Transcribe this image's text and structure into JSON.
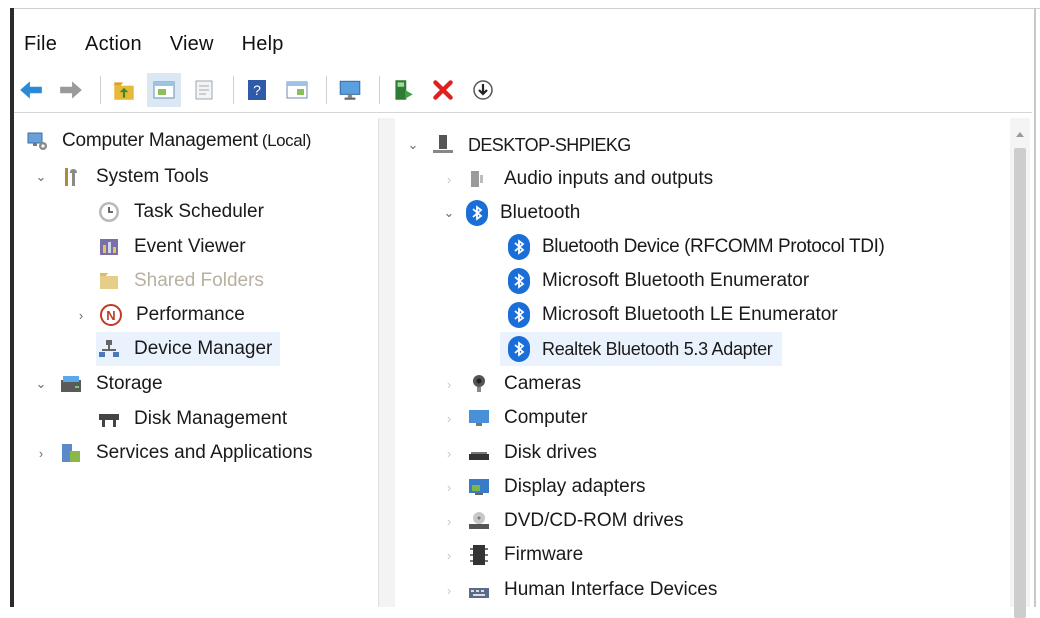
{
  "menu": {
    "file": "File",
    "action": "Action",
    "view": "View",
    "help": "Help"
  },
  "toolbar": {
    "icons": [
      "back-arrow-icon",
      "forward-arrow-icon",
      "up-folder-icon",
      "show-hide-tree-icon",
      "properties-icon",
      "help-icon",
      "export-list-icon",
      "monitor-icon",
      "enable-device-icon",
      "uninstall-icon",
      "update-driver-icon"
    ]
  },
  "tree": {
    "root": "Computer Management",
    "root_suffix": "(Local)",
    "system_tools": "System Tools",
    "task_scheduler": "Task Scheduler",
    "event_viewer": "Event Viewer",
    "shared_folders": "Shared Folders",
    "performance": "Performance",
    "device_manager": "Device Manager",
    "storage": "Storage",
    "disk_management": "Disk Management",
    "services": "Services and Applications"
  },
  "devices": {
    "computer_name": "DESKTOP-SHPIEKG",
    "audio": "Audio inputs and outputs",
    "bluetooth": "Bluetooth",
    "bt_items": [
      "Bluetooth Device (RFCOMM Protocol TDI)",
      "Microsoft Bluetooth Enumerator",
      "Microsoft Bluetooth LE Enumerator",
      "Realtek Bluetooth 5.3 Adapter"
    ],
    "cameras": "Cameras",
    "computer": "Computer",
    "disk_drives": "Disk drives",
    "display_adapters": "Display adapters",
    "dvd": "DVD/CD-ROM drives",
    "firmware": "Firmware",
    "hid": "Human Interface Devices"
  },
  "colors": {
    "accent": "#1a6ed8",
    "selection": "#eaf3fd",
    "delete_red": "#e02020",
    "back_blue": "#2a8ad8"
  }
}
